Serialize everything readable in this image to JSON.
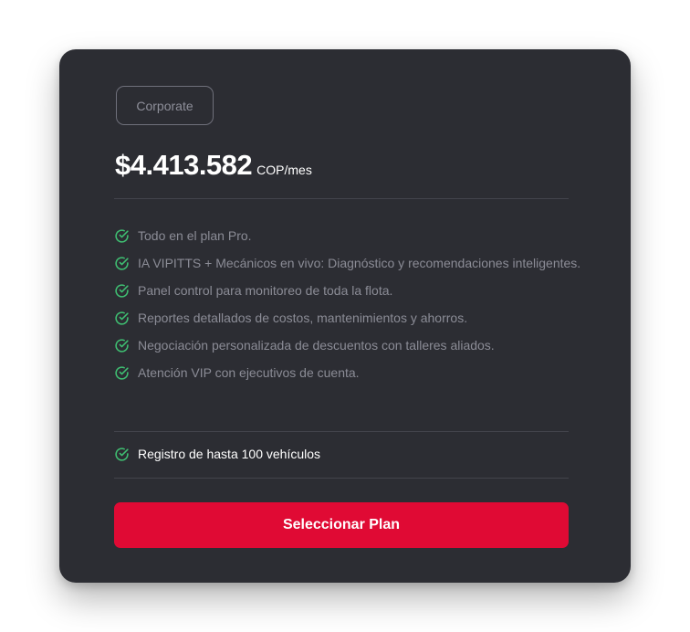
{
  "plan": {
    "name": "Corporate",
    "price": "$4.413.582",
    "price_unit": "COP/mes"
  },
  "features": [
    "Todo en el plan Pro.",
    "IA VIPITTS + Mecánicos en vivo: Diagnóstico y recomendaciones inteligentes.",
    "Panel control para monitoreo de toda la flota.",
    "Reportes detallados de costos, mantenimientos y ahorros.",
    "Negociación personalizada de descuentos con talleres aliados.",
    "Atención VIP con ejecutivos de cuenta."
  ],
  "vehicle_limit": "Registro de hasta 100 vehículos",
  "cta_label": "Seleccionar Plan",
  "colors": {
    "card_bg": "#2c2d33",
    "accent": "#e00a34",
    "check": "#3fbf72"
  },
  "icons": {
    "check": "check-circle-icon"
  }
}
